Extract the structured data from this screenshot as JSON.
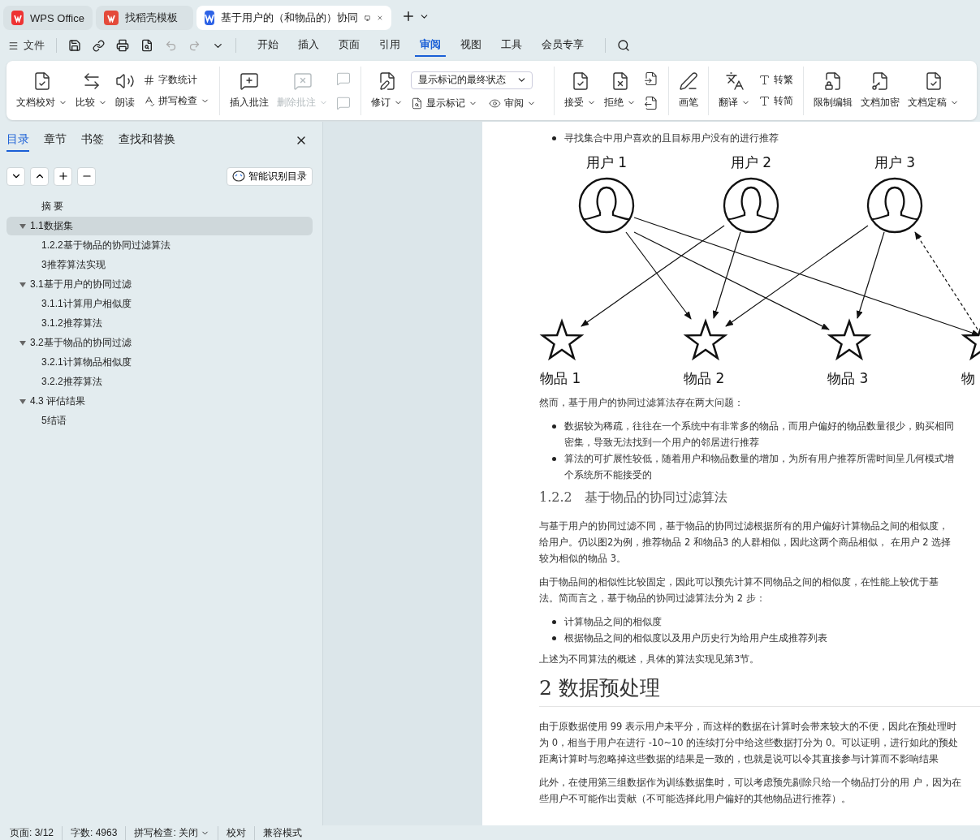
{
  "app_tabs": [
    {
      "kind": "wps",
      "label": "WPS Office",
      "selected": false
    },
    {
      "kind": "docer",
      "label": "找稻壳模板",
      "selected": false
    },
    {
      "kind": "doc",
      "label": "基于用户的（和物品的）协同",
      "selected": true
    }
  ],
  "menu": {
    "file": "文件",
    "tabs": [
      {
        "label": "开始",
        "selected": false
      },
      {
        "label": "插入",
        "selected": false
      },
      {
        "label": "页面",
        "selected": false
      },
      {
        "label": "引用",
        "selected": false
      },
      {
        "label": "审阅",
        "selected": true
      },
      {
        "label": "视图",
        "selected": false
      },
      {
        "label": "工具",
        "selected": false
      },
      {
        "label": "会员专享",
        "selected": false
      }
    ]
  },
  "ribbon": {
    "groups": [
      {
        "items": [
          {
            "kind": "big",
            "label": "文档校对",
            "dropdown": true,
            "disabled": false
          },
          {
            "kind": "big",
            "label": "比较",
            "dropdown": true,
            "disabled": false
          },
          {
            "kind": "big",
            "label": "朗读",
            "dropdown": false,
            "disabled": false
          },
          {
            "kind": "stack",
            "rows": [
              {
                "label": "字数统计",
                "dropdown": false
              },
              {
                "label": "拼写检查",
                "dropdown": true
              }
            ]
          }
        ]
      },
      {
        "items": [
          {
            "kind": "big",
            "label": "插入批注",
            "dropdown": false,
            "disabled": false
          },
          {
            "kind": "big",
            "label": "删除批注",
            "dropdown": true,
            "disabled": true
          },
          {
            "kind": "icons",
            "disabled": true
          }
        ]
      },
      {
        "items": [
          {
            "kind": "big",
            "label": "修订",
            "dropdown": true,
            "disabled": false
          },
          {
            "kind": "select",
            "value": "显示标记的最终状态",
            "rows": [
              {
                "label": "显示标记",
                "dropdown": true
              },
              {
                "label": "审阅",
                "dropdown": true
              }
            ]
          }
        ]
      },
      {
        "items": [
          {
            "kind": "big",
            "label": "接受",
            "dropdown": true,
            "disabled": false
          },
          {
            "kind": "big",
            "label": "拒绝",
            "dropdown": true,
            "disabled": false
          },
          {
            "kind": "icons",
            "disabled": false
          }
        ]
      },
      {
        "items": [
          {
            "kind": "big",
            "label": "画笔",
            "dropdown": false,
            "disabled": false
          }
        ]
      },
      {
        "items": [
          {
            "kind": "big",
            "label": "翻译",
            "dropdown": true,
            "disabled": false
          },
          {
            "kind": "stack",
            "rows": [
              {
                "label": "转繁",
                "dropdown": false
              },
              {
                "label": "转简",
                "dropdown": false
              }
            ]
          }
        ]
      },
      {
        "items": [
          {
            "kind": "big",
            "label": "限制编辑",
            "dropdown": false,
            "disabled": false
          },
          {
            "kind": "big",
            "label": "文档加密",
            "dropdown": false,
            "disabled": false
          },
          {
            "kind": "big",
            "label": "文档定稿",
            "dropdown": true,
            "disabled": false
          }
        ]
      }
    ]
  },
  "nav_panel": {
    "tabs": [
      {
        "label": "目录",
        "selected": true
      },
      {
        "label": "章节",
        "selected": false
      },
      {
        "label": "书签",
        "selected": false
      },
      {
        "label": "查找和替换",
        "selected": false
      }
    ],
    "smart_button": "智能识别目录",
    "toc": [
      {
        "label": "摘 要",
        "selected": false
      },
      {
        "label": "1.1数据集",
        "selected": true,
        "expanded": true,
        "children": [
          {
            "label": "1.2.2基于物品的协同过滤算法",
            "selected": false
          },
          {
            "label": "3推荐算法实现",
            "selected": false
          }
        ]
      },
      {
        "label": "3.1基于用户的协同过滤",
        "selected": false,
        "expanded": true,
        "children": [
          {
            "label": "3.1.1计算用户相似度",
            "selected": false
          },
          {
            "label": "3.1.2推荐算法",
            "selected": false
          }
        ]
      },
      {
        "label": "3.2基于物品的协同过滤",
        "selected": false,
        "expanded": true,
        "children": [
          {
            "label": "3.2.1计算物品相似度",
            "selected": false
          },
          {
            "label": "3.2.2推荐算法",
            "selected": false
          }
        ]
      },
      {
        "label": "4.3 评估结果",
        "selected": false,
        "expanded": true,
        "children": [
          {
            "label": "5结语",
            "selected": false
          }
        ]
      }
    ]
  },
  "document": [
    {
      "kind": "bullets",
      "items": [
        [
          "寻找集合中用户喜欢的且目标用户没有的进行推荐"
        ]
      ]
    },
    {
      "kind": "diagram",
      "users": [
        "用户 1",
        "用户 2",
        "用户 3"
      ],
      "items": [
        "物品 1",
        "物品 2",
        "物品 3",
        "物"
      ]
    },
    {
      "kind": "para",
      "lines": [
        "然而，基于用户的协同过滤算法存在两大问题："
      ]
    },
    {
      "kind": "bullets",
      "items": [
        [
          "数据较为稀疏，往往在一个系统中有非常多的物品，而用户偏好的物品数量很少，购买相同",
          "密集，导致无法找到一个用户的邻居进行推荐"
        ],
        [
          "算法的可扩展性较低，随着用户和物品数量的增加，为所有用户推荐所需时间呈几何模式增",
          "个系统所不能接受的"
        ]
      ]
    },
    {
      "kind": "h3",
      "number": "1.2.2",
      "text": "基于物品的协同过滤算法"
    },
    {
      "kind": "para",
      "lines": [
        "与基于用户的协同过滤不同，基于物品的协同过滤根据所有的用户偏好计算物品之间的相似度，",
        "给用户。仍以图2为例，推荐物品 2 和物品3 的人群相似，因此这两个商品相似， 在用户 2 选择",
        "较为相似的物品 3。"
      ]
    },
    {
      "kind": "para",
      "lines": [
        "由于物品间的相似性比较固定，因此可以预先计算不同物品之间的相似度，在性能上较优于基",
        "法。简而言之，基于物品的协同过滤算法分为 2 步："
      ]
    },
    {
      "kind": "bullets",
      "items": [
        [
          "计算物品之间的相似度"
        ],
        [
          "根据物品之间的相似度以及用户历史行为给用户生成推荐列表"
        ]
      ]
    },
    {
      "kind": "para",
      "lines": [
        "上述为不同算法的概述，具体的算法实现见第3节。"
      ]
    },
    {
      "kind": "h1",
      "text": "2 数据预处理"
    },
    {
      "kind": "para",
      "lines": [
        "由于原数据使用 99 表示用户未平分，而这样的数据在计算时会带来较大的不便，因此在预处理时",
        "为 0，相当于用户在进行 -10~10 的连续打分中给这些数据打分为 0。可以证明，进行如此的预处",
        "距离计算时与忽略掉这些数据的结果是一致的，也就是说可以令其直接参与计算而不影响结果"
      ]
    },
    {
      "kind": "para",
      "lines": [
        "此外，在使用第三组数据作为训练数据集时，可以考虑预先剔除只给一个物品打分的用 户，因为在",
        "些用户不可能作出贡献（不可能选择此用户偏好的其他物品进行推荐）。"
      ]
    }
  ],
  "status_bar": [
    {
      "kind": "text",
      "label": "页面: 3/12"
    },
    {
      "kind": "text",
      "label": "字数: 4963"
    },
    {
      "kind": "dropdown",
      "label": "拼写检查: 关闭"
    },
    {
      "kind": "text",
      "label": "校对"
    },
    {
      "kind": "text",
      "label": "兼容模式"
    }
  ]
}
